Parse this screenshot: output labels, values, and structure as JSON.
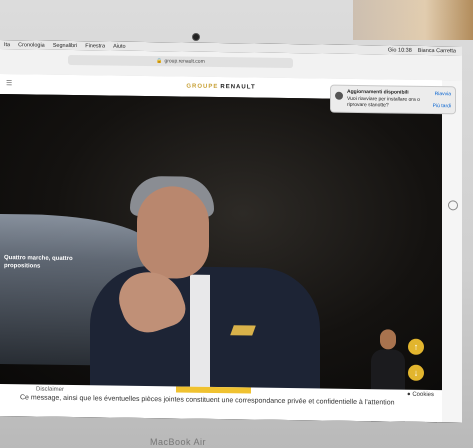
{
  "menubar": {
    "app_label": "Ita",
    "items": [
      "Cronologia",
      "Segnalibri",
      "Finestra",
      "Aiuto"
    ],
    "clock": "Gio 10:38",
    "user": "Bianca Carretta"
  },
  "browser": {
    "url": "group.renault.com"
  },
  "site": {
    "brand_prefix": "GROUPE",
    "brand_name": "RENAULT",
    "car_caption": "Quattro marche, quattro propositions",
    "disclaimer_head": "Disclaimer",
    "disclaimer": "Ce message, ainsi que les éventuelles pièces jointes constituent une correspondance privée et confidentielle à l'attention",
    "cookies_label": "Cookies"
  },
  "notification": {
    "title": "Aggiornamenti disponibili",
    "body": "Vuoi riavviare per installare ora o riprovare stanotte?",
    "action_primary": "Riavvia",
    "action_secondary": "Più tardi"
  },
  "device": {
    "model": "MacBook Air"
  },
  "colors": {
    "accent_yellow": "#f0c230",
    "suit_navy": "#1d2435"
  },
  "dock_icons": [
    "finder-icon",
    "safari-icon",
    "mail-icon",
    "notes-icon",
    "calendar-icon",
    "photos-icon",
    "music-icon",
    "appstore-icon",
    "settings-icon",
    "skype-icon",
    "chrome-icon",
    "trash-icon"
  ]
}
